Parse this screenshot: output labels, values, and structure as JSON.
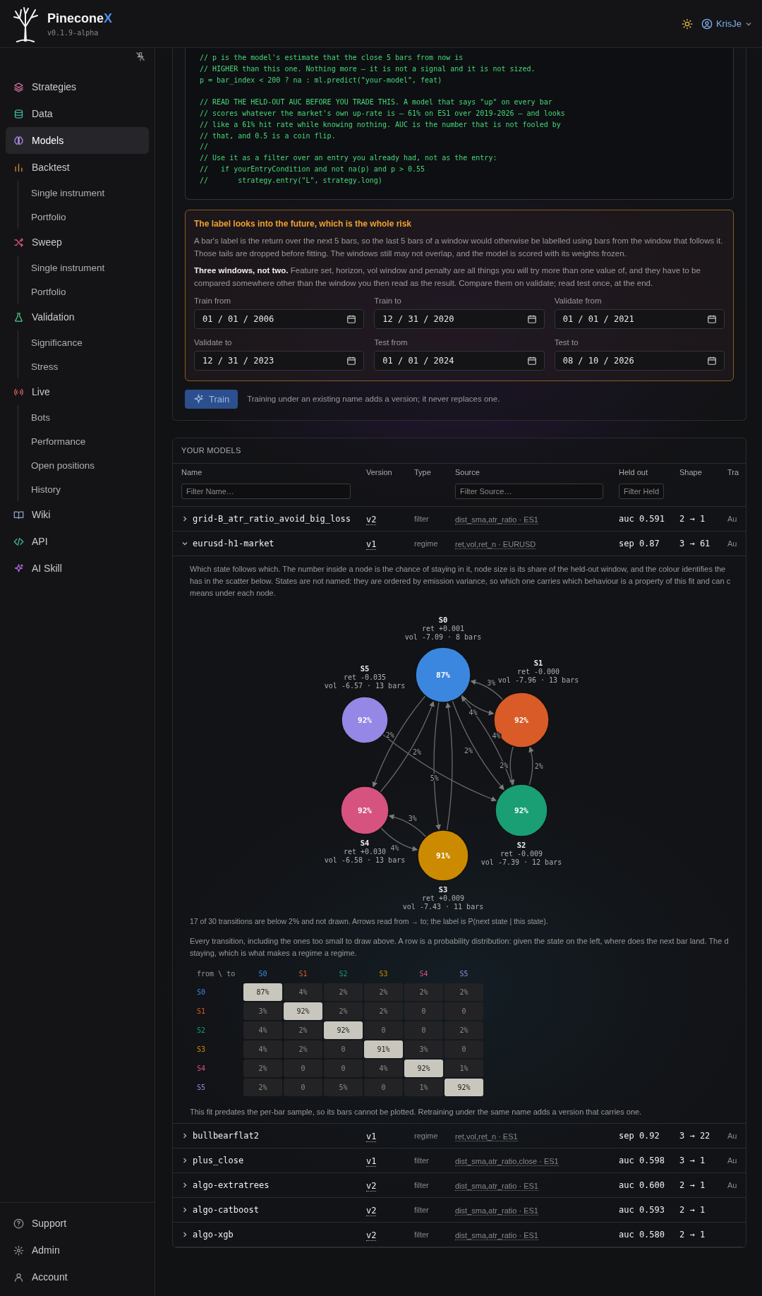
{
  "header": {
    "brand": "Pinecone",
    "brand_accent": "X",
    "version": "v0.1.9-alpha",
    "user": "KrisJe"
  },
  "sidebar": {
    "items": [
      {
        "label": "Strategies",
        "selected": false
      },
      {
        "label": "Data",
        "selected": false
      },
      {
        "label": "Models",
        "selected": true
      },
      {
        "label": "Backtest",
        "selected": false,
        "children": [
          {
            "label": "Single instrument",
            "selected": false
          },
          {
            "label": "Portfolio",
            "selected": false
          }
        ]
      },
      {
        "label": "Sweep",
        "selected": false,
        "children": [
          {
            "label": "Single instrument",
            "selected": false
          },
          {
            "label": "Portfolio",
            "selected": false
          }
        ]
      },
      {
        "label": "Validation",
        "selected": false,
        "children": [
          {
            "label": "Significance",
            "selected": false
          },
          {
            "label": "Stress",
            "selected": false
          }
        ]
      },
      {
        "label": "Live",
        "selected": false,
        "children": [
          {
            "label": "Bots",
            "selected": false
          },
          {
            "label": "Performance",
            "selected": false
          },
          {
            "label": "Open positions",
            "selected": false
          },
          {
            "label": "History",
            "selected": false
          }
        ]
      },
      {
        "label": "Wiki",
        "selected": false
      },
      {
        "label": "API",
        "selected": false
      },
      {
        "label": "AI Skill",
        "selected": false
      }
    ],
    "footer_items": [
      {
        "label": "Support"
      },
      {
        "label": "Admin"
      },
      {
        "label": "Account"
      }
    ]
  },
  "code": {
    "blocks": [
      [
        "// p is the model's estimate that the close 5 bars from now is",
        "// HIGHER than this one. Nothing more — it is not a signal and it is not sized.",
        "p = bar_index < 200 ? na : ml.predict(\"your-model\", feat)"
      ],
      [
        "// READ THE HELD-OUT AUC BEFORE YOU TRADE THIS. A model that says \"up\" on every bar",
        "// scores whatever the market's own up-rate is — 61% on ES1 over 2019-2026 — and looks",
        "// like a 61% hit rate while knowing nothing. AUC is the number that is not fooled by",
        "// that, and 0.5 is a coin flip.",
        "//",
        "// Use it as a filter over an entry you already had, not as the entry:",
        "//   if yourEntryCondition and not na(p) and p > 0.55",
        "//       strategy.entry(\"L\", strategy.long)"
      ]
    ]
  },
  "notice": {
    "title": "The label looks into the future, which is the whole risk",
    "paragraphs": [
      "A bar's label is the return over the next 5 bars, so the last 5 bars of a window would otherwise be labelled using bars from the window that follows it. Those tails are dropped before fitting. The windows still may not overlap, and the model is scored with its weights frozen.",
      "**Three windows, not two.** Feature set, horizon, vol window and penalty are all things you will try more than one value of, and they have to be compared somewhere other than the window you then read as the result. Compare them on validate; read test once, at the end."
    ]
  },
  "dates": [
    {
      "label": "Train from",
      "value": "01 / 01 / 2006"
    },
    {
      "label": "Train to",
      "value": "12 / 31 / 2020"
    },
    {
      "label": "Validate from",
      "value": "01 / 01 / 2021"
    },
    {
      "label": "Validate to",
      "value": "12 / 31 / 2023"
    },
    {
      "label": "Test from",
      "value": "01 / 01 / 2024"
    },
    {
      "label": "Test to",
      "value": "08 / 10 / 2026"
    }
  ],
  "train": {
    "button": "Train",
    "hint": "Training under an existing name adds a version; it never replaces one."
  },
  "models": {
    "title": "YOUR MODELS",
    "columns": [
      "Name",
      "Version",
      "Type",
      "Source",
      "Held out",
      "Shape",
      "Tra"
    ],
    "filters": {
      "name": {
        "placeholder": "Filter Name…"
      },
      "source": {
        "placeholder": "Filter Source…"
      },
      "held_out": {
        "placeholder": "Filter Held"
      }
    },
    "rows": [
      {
        "name": "grid-B_atr_ratio_avoid_big_loss",
        "version": "v2",
        "type": "filter",
        "source": "dist_sma,atr_ratio · ES1",
        "held_out": "auc 0.591",
        "shape": "2 → 1",
        "column_7": "Au",
        "expanded": false
      },
      {
        "name": "eurusd-h1-market",
        "version": "v1",
        "type": "regime",
        "source": "ret,vol,ret_n · EURUSD",
        "held_out": "sep 0.87",
        "shape": "3 → 61",
        "column_7": "Au",
        "expanded": true,
        "detail": {
          "description": "Which state follows which. The number inside a node is the chance of staying in it, node size is its share of the held-out window, and the colour identifies the has in the scatter below. States are not named: they are ordered by emission variance, so which one carries which behaviour is a property of this fit and can c means under each node.",
          "states": [
            {
              "name": "S0",
              "stay": "87%",
              "ret": "ret +0.001",
              "vol": "vol -7.09 · 8 bars",
              "color": "#3b87e0",
              "arrows": [
                null,
                {
                  "label": "4%"
                },
                {
                  "label": "2%"
                },
                {
                  "drawn": true
                },
                {
                  "label": "2%"
                },
                null
              ]
            },
            {
              "name": "S1",
              "stay": "92%",
              "ret": "ret -0.000",
              "vol": "vol -7.96 · 13 bars",
              "color": "#d95b27",
              "arrows": [
                {
                  "label": "3%"
                },
                null,
                {
                  "label": "2%"
                },
                null,
                null,
                null
              ]
            },
            {
              "name": "S5",
              "stay": "92%",
              "ret": "ret -0.035",
              "vol": "vol -6.57 · 13 bars",
              "color": "#9487e6",
              "arrows": [
                null,
                null,
                {
                  "label": "5%"
                },
                null,
                null,
                null
              ]
            },
            {
              "name": "S4",
              "stay": "92%",
              "ret": "ret +0.030",
              "vol": "vol -6.58 · 13 bars",
              "color": "#d6537f",
              "arrows": [
                {
                  "label": "2%"
                },
                null,
                null,
                {
                  "label": "4%"
                },
                null,
                null
              ]
            },
            {
              "name": "S2",
              "stay": "92%",
              "ret": "ret -0.009",
              "vol": "vol -7.39 · 12 bars",
              "color": "#1a9e74",
              "arrows": [
                {
                  "label": "4%"
                },
                {
                  "label": "2%"
                },
                null,
                null,
                null,
                null
              ]
            },
            {
              "name": "S3",
              "stay": "91%",
              "ret": "ret +0.009",
              "vol": "vol -7.43 · 11 bars",
              "color": "#cc8a00",
              "arrows": [
                {
                  "drawn": true
                },
                null,
                null,
                null,
                {
                  "label": "3%"
                },
                null
              ]
            }
          ],
          "footnote": "17 of 30 transitions are below 2% and not drawn. Arrows read from → to; the label is P(next state | this state).",
          "matrix_intro": "Every transition, including the ones too small to draw above. A row is a probability distribution: given the state on the left, where does the next bar land. The d staying, which is what makes a regime a regime.",
          "matrix": {
            "corner": "from \\ to",
            "columns": [
              "S0",
              "S1",
              "S2",
              "S3",
              "S4",
              "S5"
            ],
            "rows": [
              {
                "label": "S0",
                "values": [
                  "87%",
                  "4%",
                  "2%",
                  "2%",
                  "2%",
                  "2%"
                ]
              },
              {
                "label": "S1",
                "values": [
                  "3%",
                  "92%",
                  "2%",
                  "2%",
                  "0",
                  "0"
                ]
              },
              {
                "label": "S2",
                "values": [
                  "4%",
                  "2%",
                  "92%",
                  "0",
                  "0",
                  "2%"
                ]
              },
              {
                "label": "S3",
                "values": [
                  "4%",
                  "2%",
                  "0",
                  "91%",
                  "3%",
                  "0"
                ]
              },
              {
                "label": "S4",
                "values": [
                  "2%",
                  "0",
                  "0",
                  "4%",
                  "92%",
                  "1%"
                ]
              },
              {
                "label": "S5",
                "values": [
                  "2%",
                  "0",
                  "5%",
                  "0",
                  "1%",
                  "92%"
                ]
              }
            ]
          },
          "note": "This fit predates the per-bar sample, so its bars cannot be plotted. Retraining under the same name adds a version that carries one."
        }
      },
      {
        "name": "bullbearflat2",
        "version": "v1",
        "type": "regime",
        "source": "ret,vol,ret_n · ES1",
        "held_out": "sep 0.92",
        "shape": "3 → 22",
        "column_7": "Au",
        "expanded": false
      },
      {
        "name": "plus_close",
        "version": "v1",
        "type": "filter",
        "source": "dist_sma,atr_ratio,close · ES1",
        "held_out": "auc 0.598",
        "shape": "3 → 1",
        "column_7": "Au",
        "expanded": false
      },
      {
        "name": "algo-extratrees",
        "version": "v2",
        "type": "filter",
        "source": "dist_sma,atr_ratio · ES1",
        "held_out": "auc 0.600",
        "shape": "2 → 1",
        "column_7": "Au",
        "expanded": false
      },
      {
        "name": "algo-catboost",
        "version": "v2",
        "type": "filter",
        "source": "dist_sma,atr_ratio · ES1",
        "held_out": "auc 0.593",
        "shape": "2 → 1",
        "expanded": false
      },
      {
        "name": "algo-xgb",
        "version": "v2",
        "type": "filter",
        "source": "dist_sma,atr_ratio · ES1",
        "held_out": "auc 0.580",
        "shape": "2 → 1",
        "expanded": false
      }
    ]
  }
}
